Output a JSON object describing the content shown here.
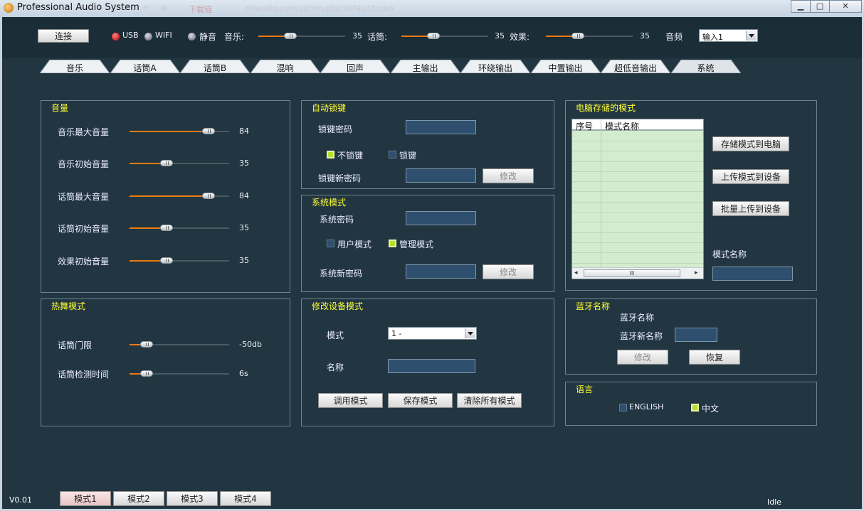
{
  "window": {
    "title": "Professional Audio System",
    "faded_title": "rkiaudio.com/admin.php/default/index",
    "faded_tip": "下载链"
  },
  "topbar": {
    "connect_label": "连接",
    "usb_label": "USB",
    "wifi_label": "WIFI",
    "mute_label": "静音",
    "music_label": "音乐:",
    "music_value": "35",
    "music_level": 0.35,
    "mic_label": "话筒:",
    "mic_value": "35",
    "mic_level": 0.35,
    "effect_label": "效果:",
    "effect_value": "35",
    "effect_level": 0.35,
    "audio_label": "音频",
    "input_selected": "输入1"
  },
  "tabs": [
    "音乐",
    "话筒A",
    "话筒B",
    "混响",
    "回声",
    "主输出",
    "环绕输出",
    "中置输出",
    "超低音输出",
    "系统"
  ],
  "active_tab": "系统",
  "volume": {
    "title": "音量",
    "rows": [
      {
        "label": "音乐最大音量",
        "value": "84",
        "level": 0.84
      },
      {
        "label": "音乐初始音量",
        "value": "35",
        "level": 0.35
      },
      {
        "label": "话筒最大音量",
        "value": "84",
        "level": 0.84
      },
      {
        "label": "话筒初始音量",
        "value": "35",
        "level": 0.35
      },
      {
        "label": "效果初始音量",
        "value": "35",
        "level": 0.35
      }
    ]
  },
  "hotdance": {
    "title": "热舞模式",
    "rows": [
      {
        "label": "话筒门限",
        "value": "-50db",
        "level": 0.12
      },
      {
        "label": "话筒检测时间",
        "value": "6s",
        "level": 0.12
      }
    ]
  },
  "autolock": {
    "title": "自动锁键",
    "password_label": "锁键密码",
    "unlock_label": "不锁键",
    "lock_label": "锁键",
    "new_password_label": "锁键新密码",
    "modify_label": "修改"
  },
  "sysmode": {
    "title": "系统模式",
    "password_label": "系统密码",
    "user_mode_label": "用户模式",
    "admin_mode_label": "管理模式",
    "new_password_label": "系统新密码",
    "modify_label": "修改"
  },
  "devmode": {
    "title": "修改设备模式",
    "mode_label": "模式",
    "mode_selected": "1 -",
    "name_label": "名称",
    "load_label": "调用模式",
    "save_label": "保存模式",
    "clear_label": "清除所有模式"
  },
  "pcstore": {
    "title": "电脑存储的模式",
    "col_no": "序号",
    "col_name": "模式名称",
    "store_label": "存储模式到电脑",
    "upload_label": "上传模式到设备",
    "batch_label": "批量上传到设备",
    "mode_name_label": "模式名称",
    "scroll_grip": "III"
  },
  "bluetooth": {
    "title": "蓝牙名称",
    "name_label": "蓝牙名称",
    "new_name_label": "蓝牙新名称",
    "modify_label": "修改",
    "restore_label": "恢复"
  },
  "language": {
    "title": "语言",
    "english_label": "ENGLISH",
    "chinese_label": "中文"
  },
  "statusbar": {
    "version": "V0.01",
    "modes": [
      "模式1",
      "模式2",
      "模式3",
      "模式4"
    ],
    "status": "Idle"
  },
  "colors": {
    "accent_orange": "#f07a12",
    "section_title": "#ffff33",
    "background": "#223642",
    "checkbox_on": "#b7e026"
  }
}
